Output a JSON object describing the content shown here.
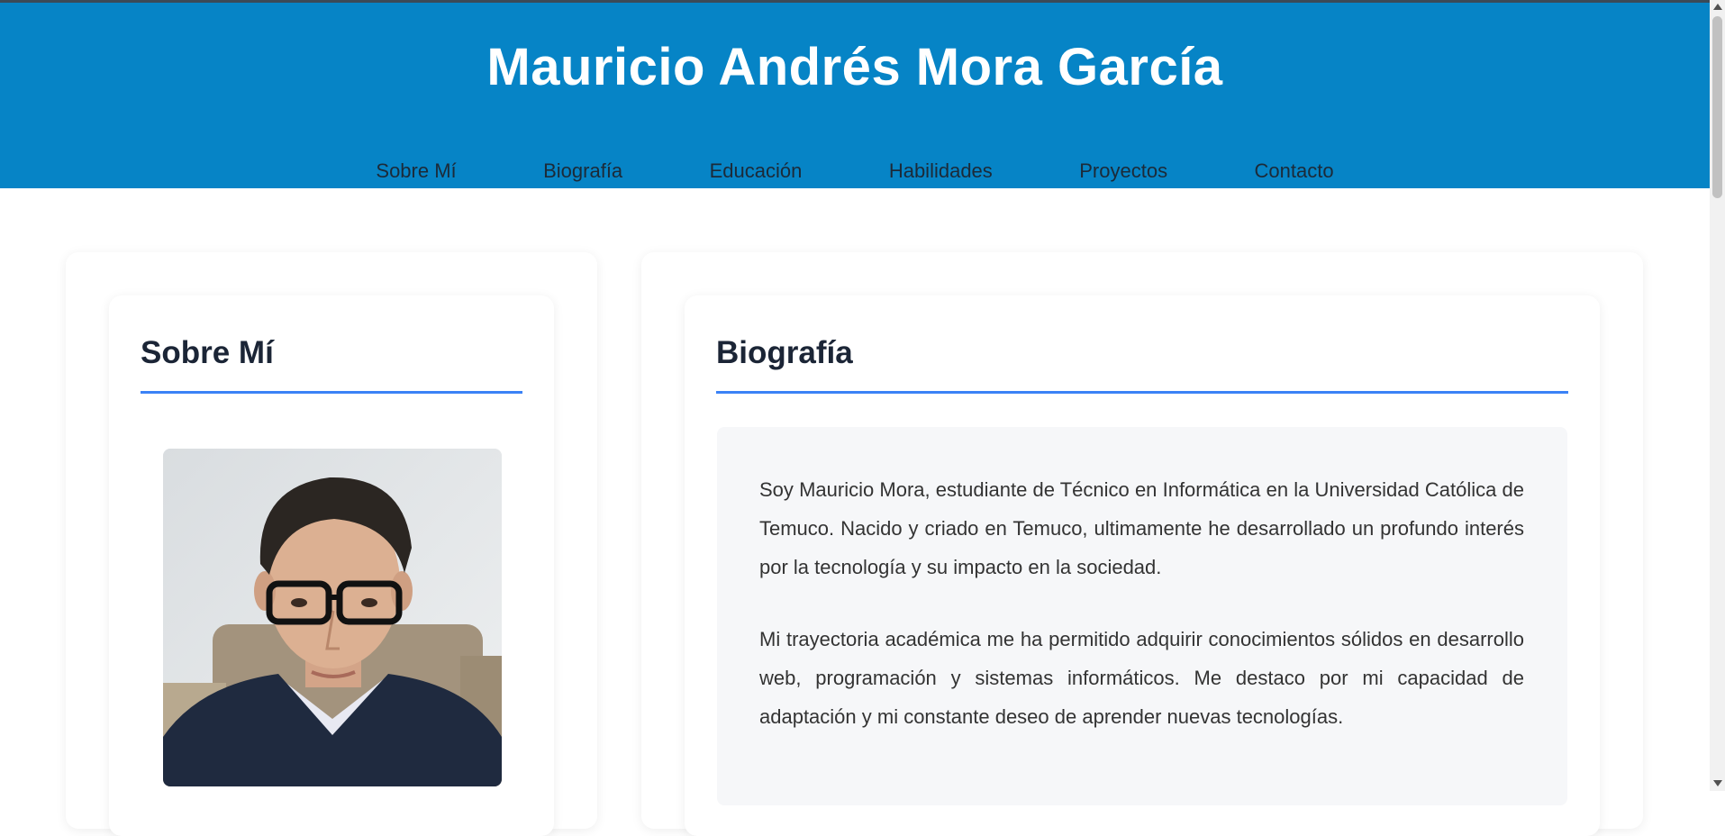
{
  "header": {
    "title": "Mauricio Andrés Mora García"
  },
  "nav": {
    "items": [
      "Sobre Mí",
      "Biografía",
      "Educación",
      "Habilidades",
      "Proyectos",
      "Contacto"
    ]
  },
  "about": {
    "heading": "Sobre Mí"
  },
  "biography": {
    "heading": "Biografía",
    "paragraphs": [
      "Soy Mauricio Mora, estudiante de Técnico en Informática en la Universidad Católica de Temuco. Nacido y criado en Temuco, ultimamente he desarrollado un profundo interés por la tecnología y su impacto en la sociedad.",
      "Mi trayectoria académica me ha permitido adquirir conocimientos sólidos en desarrollo web, programación y sistemas informáticos. Me destaco por mi capacidad de adaptación y mi constante deseo de aprender nuevas tecnologías."
    ]
  },
  "colors": {
    "header_bg": "#0684c6",
    "accent": "#3b82f6",
    "heading_text": "#1b2536"
  }
}
